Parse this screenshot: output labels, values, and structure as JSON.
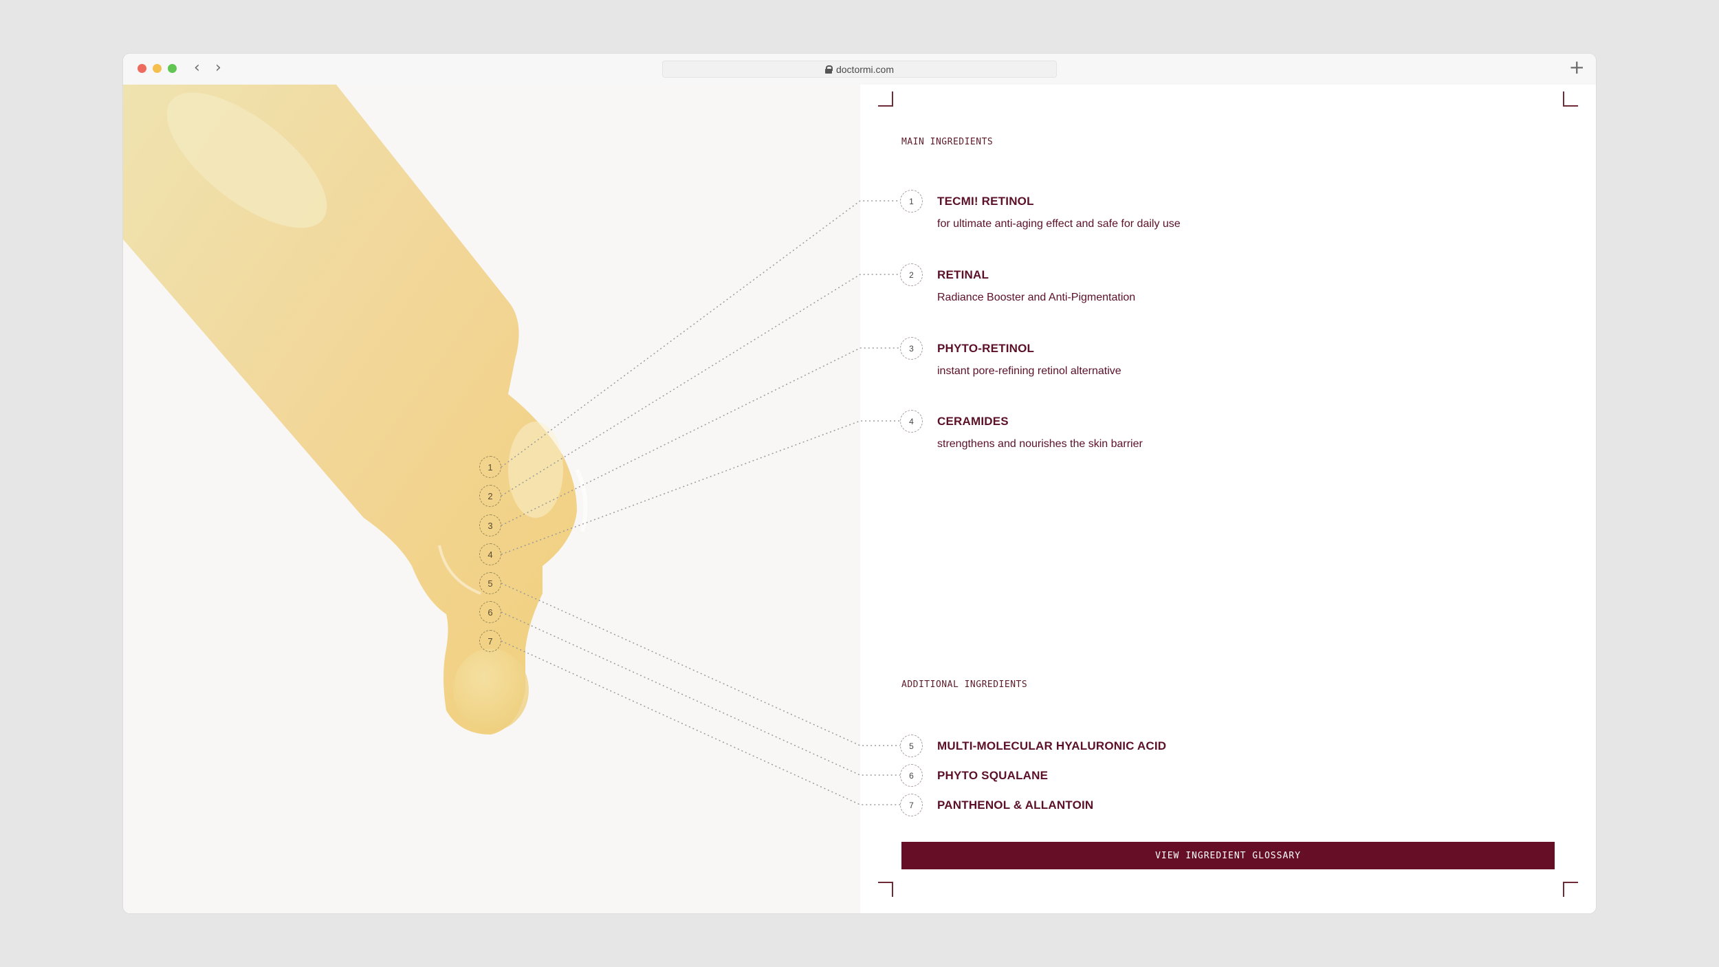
{
  "browser": {
    "url": "doctormi.com",
    "icons": [
      "close-dot",
      "minimize-dot",
      "maximize-dot",
      "back-arrow-icon",
      "forward-arrow-icon",
      "lock-icon",
      "plus-icon"
    ]
  },
  "main_ingredients": {
    "label": "MAIN INGREDIENTS",
    "items": [
      {
        "num": "1",
        "name": "TECMI! RETINOL",
        "desc": "for ultimate anti-aging effect and safe for daily use"
      },
      {
        "num": "2",
        "name": "RETINAL",
        "desc": "Radiance Booster and Anti-Pigmentation"
      },
      {
        "num": "3",
        "name": "PHYTO-RETINOL",
        "desc": "instant pore-refining retinol alternative"
      },
      {
        "num": "4",
        "name": "CERAMIDES",
        "desc": "strengthens and nourishes the skin barrier"
      }
    ]
  },
  "additional_ingredients": {
    "label": "ADDITIONAL INGREDIENTS",
    "items": [
      {
        "num": "5",
        "name": "MULTI-MOLECULAR HYALURONIC ACID"
      },
      {
        "num": "6",
        "name": "PHYTO SQUALANE"
      },
      {
        "num": "7",
        "name": "PANTHENOL & ALLANTOIN"
      }
    ]
  },
  "image_markers": [
    "1",
    "2",
    "3",
    "4",
    "5",
    "6",
    "7"
  ],
  "cta": {
    "label": "VIEW INGREDIENT GLOSSARY"
  },
  "colors": {
    "brand": "#650e25",
    "serum": "#f0d590",
    "left_bg": "#f8f7f5"
  }
}
